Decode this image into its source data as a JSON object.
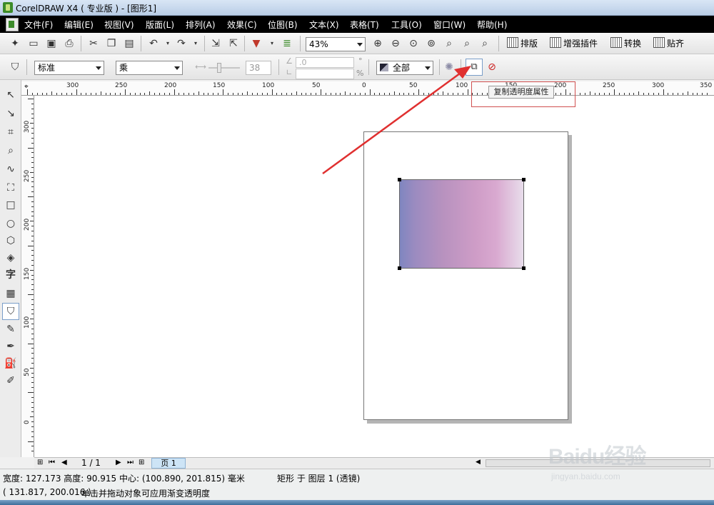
{
  "window": {
    "title": "CorelDRAW X4 ( 专业版 ) - [图形1]"
  },
  "menu": [
    "文件(F)",
    "编辑(E)",
    "视图(V)",
    "版面(L)",
    "排列(A)",
    "效果(C)",
    "位图(B)",
    "文本(X)",
    "表格(T)",
    "工具(O)",
    "窗口(W)",
    "帮助(H)"
  ],
  "toolbar1": {
    "zoom_value": "43%",
    "plugins": [
      "排版",
      "增强插件",
      "转换",
      "贴齐"
    ]
  },
  "property_bar": {
    "mode_value": "标准",
    "operation_value": "乘",
    "slider_value": "38",
    "angle_value": ".0",
    "degree_unit": "°",
    "percent_unit": "%",
    "target_value": "全部"
  },
  "tooltip": "复制透明度属性",
  "ruler": {
    "h_labels": [
      "300",
      "250",
      "200",
      "150",
      "100",
      "50",
      "0",
      "50",
      "100",
      "150",
      "200",
      "250",
      "300",
      "350"
    ],
    "v_labels": [
      "300",
      "250",
      "200",
      "150",
      "100",
      "50",
      "0"
    ]
  },
  "page_nav": {
    "counter": "1 / 1",
    "tab": "页 1"
  },
  "status": {
    "line1": "宽度: 127.173  高度: 90.915  中心: (100.890, 201.815)  毫米",
    "object_info": "矩形 于 图层 1 (透镜)",
    "coords": "( 131.817, 200.016 )",
    "hint": "单击并拖动对象可应用渐变透明度"
  },
  "colors": {
    "menubar_bg": "#000000",
    "annotation_red": "#e03030"
  },
  "watermark": {
    "logo": "Baidu经验",
    "url": "jingyan.baidu.com"
  }
}
